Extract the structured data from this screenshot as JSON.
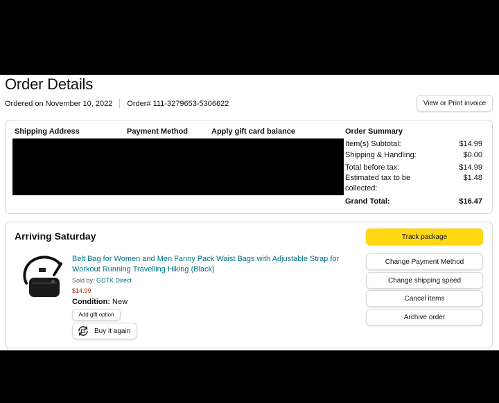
{
  "header": {
    "title": "Order Details",
    "ordered_on": "Ordered on November 10, 2022",
    "order_number": "Order# 111-3279653-5306622",
    "invoice_button": "View or Print invoice"
  },
  "details": {
    "shipping_address_label": "Shipping Address",
    "payment_method_label": "Payment Method",
    "gift_card_label": "Apply gift card balance"
  },
  "summary": {
    "title": "Order Summary",
    "rows": [
      {
        "label": "Item(s) Subtotal:",
        "value": "$14.99"
      },
      {
        "label": "Shipping & Handling:",
        "value": "$0.00"
      },
      {
        "label": "Total before tax:",
        "value": "$14.99"
      },
      {
        "label": "Estimated tax to be collected:",
        "value": "$1.48"
      }
    ],
    "grand_total_label": "Grand Total:",
    "grand_total_value": "$16.47"
  },
  "shipment": {
    "status": "Arriving Saturday",
    "product": {
      "title": "Belt Bag for Women and Men Fanny Pack Waist Bags with Adjustable Strap for Workout Running Travelling Hiking (Black)",
      "sold_by_label": "Sold by:",
      "seller": "GDTK Direct",
      "price": "$14.99",
      "condition_label": "Condition:",
      "condition_value": "New",
      "image_icon": "fanny-pack-product-image"
    },
    "add_gift_option": "Add gift option",
    "buy_again": "Buy it again",
    "buy_again_icon": "reorder-cycle-icon",
    "actions": {
      "track": "Track package",
      "change_payment": "Change Payment Method",
      "change_speed": "Change shipping speed",
      "cancel": "Cancel items",
      "archive": "Archive order"
    },
    "track_color": "#FFD814"
  }
}
